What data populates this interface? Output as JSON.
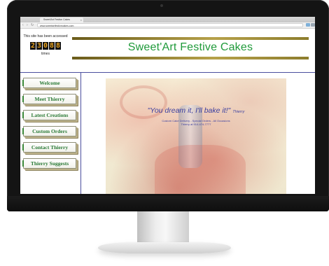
{
  "browser": {
    "tab_title": "Sweet'Art Festive Cakes",
    "tab_close": "×",
    "url": "www.sweetartfestivecakes.com",
    "traffic_lights": [
      "#e25b4b",
      "#e8b53a",
      "#62c24f"
    ],
    "icons": {
      "back": "back-arrow-icon",
      "forward": "forward-arrow-icon",
      "reload": "reload-icon"
    }
  },
  "counter": {
    "prefix": "This site has been accessed",
    "digits": [
      "2",
      "3",
      "0",
      "8",
      "8"
    ],
    "suffix": "times"
  },
  "site": {
    "title": "Sweet'Art Festive Cakes"
  },
  "menu": {
    "items": [
      {
        "label": "Welcome"
      },
      {
        "label": "Meet Thierry"
      },
      {
        "label": "Latest Creations"
      },
      {
        "label": "Custom Orders"
      },
      {
        "label": "Contact Thierry"
      },
      {
        "label": "Thierry Suggests"
      }
    ]
  },
  "hero": {
    "tagline": "\"You dream it, I'll bake it!\"",
    "signature": "Thierry",
    "subline1": "Custom Cake Delivery - Special Orders - All Occasions",
    "subline2": "Thierry at 914-474-7777"
  },
  "colors": {
    "title_green": "#1f9a3a",
    "link_blue": "#3b3fa0",
    "rule_blue": "#4b4f9e"
  }
}
